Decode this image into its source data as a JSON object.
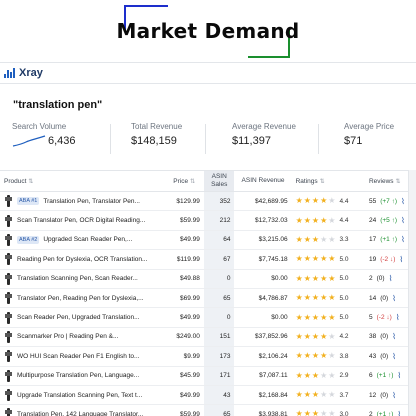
{
  "banner": {
    "title": "Market Demand"
  },
  "app": {
    "name": "Xray",
    "accent": "#1f5fbf"
  },
  "query": "\"translation pen\"",
  "stats": [
    {
      "label": "Search Volume",
      "value": "6,436"
    },
    {
      "label": "Total Revenue",
      "value": "$148,159"
    },
    {
      "label": "Average Revenue",
      "value": "$11,397"
    },
    {
      "label": "Average Price",
      "value": "$71"
    }
  ],
  "table": {
    "headers": {
      "product": "Product",
      "price": "Price",
      "asin_sales": "ASIN Sales",
      "asin_revenue": "ASIN Revenue",
      "ratings": "Ratings",
      "reviews": "Reviews"
    },
    "rows": [
      {
        "aba": "ABA #1",
        "title": "Translation Pen, Translator Pen...",
        "price": "$129.99",
        "sales": "352",
        "revenue": "$42,689.95",
        "stars": 4.4,
        "rating": "4.4",
        "reviews": "55",
        "delta": "(+7 ↑)",
        "dir": "up"
      },
      {
        "aba": "",
        "title": "Scan Translator Pen, OCR Digital Reading...",
        "price": "$59.99",
        "sales": "212",
        "revenue": "$12,732.03",
        "stars": 4.4,
        "rating": "4.4",
        "reviews": "24",
        "delta": "(+5 ↑)",
        "dir": "up"
      },
      {
        "aba": "ABA #2",
        "title": "Upgraded Scan Reader Pen,...",
        "price": "$49.99",
        "sales": "64",
        "revenue": "$3,215.06",
        "stars": 3.3,
        "rating": "3.3",
        "reviews": "17",
        "delta": "(+1 ↑)",
        "dir": "up"
      },
      {
        "aba": "",
        "title": "Reading Pen for Dyslexia, OCR Translation...",
        "price": "$119.99",
        "sales": "67",
        "revenue": "$7,745.18",
        "stars": 5.0,
        "rating": "5.0",
        "reviews": "19",
        "delta": "(-2 ↓)",
        "dir": "down"
      },
      {
        "aba": "",
        "title": "Translation Scanning Pen, Scan Reader...",
        "price": "$49.88",
        "sales": "0",
        "revenue": "$0.00",
        "stars": 5.0,
        "rating": "5.0",
        "reviews": "2",
        "delta": "(0)",
        "dir": "none"
      },
      {
        "aba": "",
        "title": "Translator Pen, Reading Pen for Dyslexia,...",
        "price": "$69.99",
        "sales": "65",
        "revenue": "$4,786.87",
        "stars": 5.0,
        "rating": "5.0",
        "reviews": "14",
        "delta": "(0)",
        "dir": "none"
      },
      {
        "aba": "",
        "title": "Scan Reader Pen, Upgraded Translation...",
        "price": "$49.99",
        "sales": "0",
        "revenue": "$0.00",
        "stars": 5.0,
        "rating": "5.0",
        "reviews": "5",
        "delta": "(-2 ↓)",
        "dir": "down"
      },
      {
        "aba": "",
        "title": "Scanmarker Pro | Reading Pen &...",
        "price": "$249.00",
        "sales": "151",
        "revenue": "$37,852.96",
        "stars": 4.2,
        "rating": "4.2",
        "reviews": "38",
        "delta": "(0)",
        "dir": "none"
      },
      {
        "aba": "",
        "title": "WO HUI Scan Reader Pen F1 English to...",
        "price": "$9.99",
        "sales": "173",
        "revenue": "$2,106.24",
        "stars": 3.8,
        "rating": "3.8",
        "reviews": "43",
        "delta": "(0)",
        "dir": "none"
      },
      {
        "aba": "",
        "title": "Multipurpose Translation Pen, Language...",
        "price": "$45.99",
        "sales": "171",
        "revenue": "$7,087.11",
        "stars": 2.9,
        "rating": "2.9",
        "reviews": "6",
        "delta": "(+1 ↑)",
        "dir": "up"
      },
      {
        "aba": "",
        "title": "Upgrade Translation Scanning Pen, Text t...",
        "price": "$49.99",
        "sales": "43",
        "revenue": "$2,168.84",
        "stars": 3.7,
        "rating": "3.7",
        "reviews": "12",
        "delta": "(0)",
        "dir": "none"
      },
      {
        "aba": "",
        "title": "Translation Pen, 142 Language Translator...",
        "price": "$59.99",
        "sales": "65",
        "revenue": "$3,938.81",
        "stars": 3.0,
        "rating": "3.0",
        "reviews": "2",
        "delta": "(+1 ↑)",
        "dir": "up"
      }
    ]
  },
  "colors": {
    "star": "#f2b01e",
    "up": "#1a8f2e",
    "down": "#d23c3c",
    "link": "#2b5aa8"
  }
}
